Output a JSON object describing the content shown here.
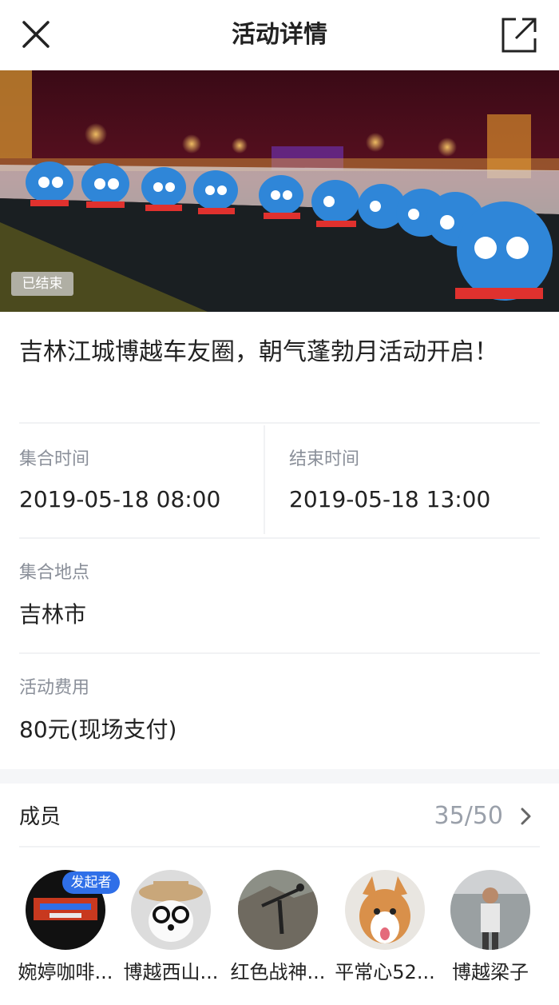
{
  "header": {
    "title": "活动详情",
    "close_icon": "close-icon",
    "share_icon": "share-icon"
  },
  "banner": {
    "status_badge": "已结束"
  },
  "activity": {
    "title": "吉林江城博越车友圈，朝气蓬勃月活动开启！"
  },
  "schedule": {
    "gather_label": "集合时间",
    "gather_time": "2019-05-18 08:00",
    "end_label": "结束时间",
    "end_time": "2019-05-18 13:00"
  },
  "location": {
    "label": "集合地点",
    "value": "吉林市"
  },
  "fee": {
    "label": "活动费用",
    "value": "80元(现场支付)"
  },
  "members": {
    "label": "成员",
    "count": "35/50",
    "organizer_badge": "发起者",
    "list": [
      {
        "name": "婉婷咖啡..."
      },
      {
        "name": "博越西山..."
      },
      {
        "name": "红色战神..."
      },
      {
        "name": "平常心52..."
      },
      {
        "name": "博越梁子"
      }
    ]
  },
  "colors": {
    "accent": "#2f6fe8",
    "label_gray": "#8a8f99",
    "separator": "#f5f6f8"
  }
}
